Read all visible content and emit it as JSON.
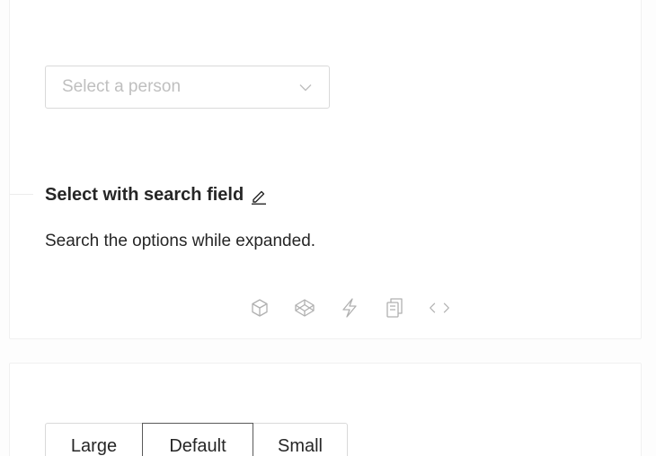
{
  "select": {
    "placeholder": "Select a person"
  },
  "section": {
    "title": "Select with search field",
    "description": "Search the options while expanded."
  },
  "actions": [
    {
      "icon": "codesandbox-icon"
    },
    {
      "icon": "codepen-icon"
    },
    {
      "icon": "stackblitz-icon"
    },
    {
      "icon": "copy-icon"
    },
    {
      "icon": "code-icon"
    }
  ],
  "size_group": {
    "options": [
      "Large",
      "Default",
      "Small"
    ],
    "selected": "Default"
  },
  "colors": {
    "text": "#262626",
    "placeholder": "#bfbfbf",
    "border": "#d9d9d9",
    "icon": "#b0b0b0"
  }
}
